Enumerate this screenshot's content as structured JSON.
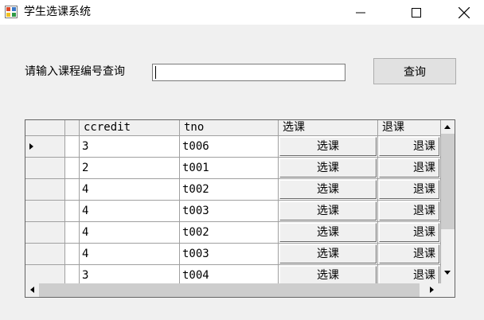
{
  "window": {
    "title": "学生选课系统"
  },
  "search": {
    "label": "请输入课程编号查询",
    "value": "",
    "placeholder": "",
    "button_label": "查询"
  },
  "table": {
    "columns": [
      "ccredit",
      "tno",
      "选课",
      "退课"
    ],
    "rows": [
      {
        "ccredit": "3",
        "tno": "t006",
        "select": "选课",
        "drop": "退课"
      },
      {
        "ccredit": "2",
        "tno": "t001",
        "select": "选课",
        "drop": "退课"
      },
      {
        "ccredit": "4",
        "tno": "t002",
        "select": "选课",
        "drop": "退课"
      },
      {
        "ccredit": "4",
        "tno": "t003",
        "select": "选课",
        "drop": "退课"
      },
      {
        "ccredit": "4",
        "tno": "t002",
        "select": "选课",
        "drop": "退课"
      },
      {
        "ccredit": "4",
        "tno": "t003",
        "select": "选课",
        "drop": "退课"
      },
      {
        "ccredit": "3",
        "tno": "t004",
        "select": "选课",
        "drop": "退课"
      }
    ]
  },
  "icons": {
    "app": "app-window-icon",
    "minimize": "minimize-icon",
    "maximize": "maximize-icon",
    "close": "close-icon"
  }
}
